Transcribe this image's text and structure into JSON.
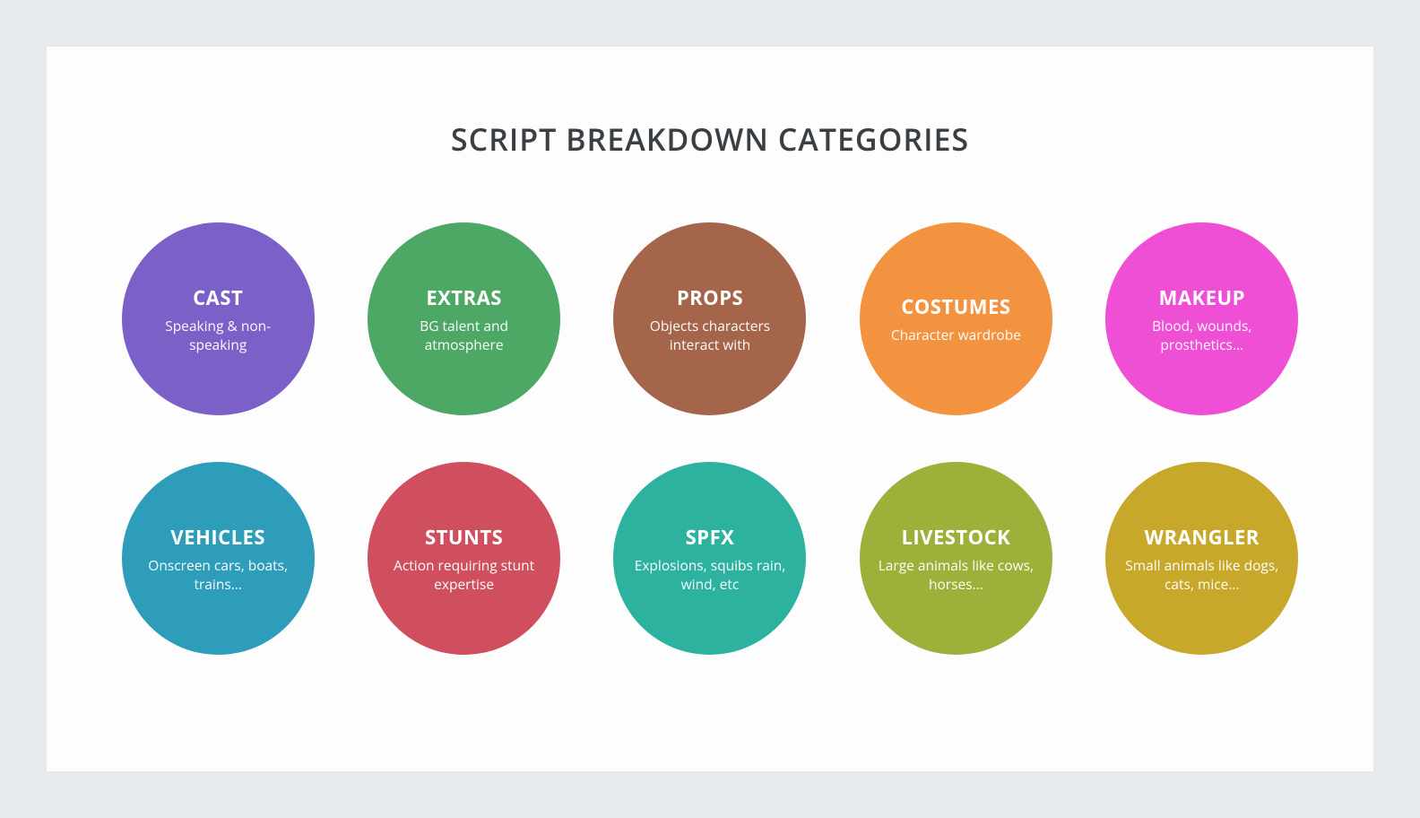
{
  "title": "SCRIPT BREAKDOWN CATEGORIES",
  "categories": [
    {
      "name": "CAST",
      "desc": "Speaking & non-speaking",
      "color": "#7a60c7"
    },
    {
      "name": "EXTRAS",
      "desc": "BG talent and atmosphere",
      "color": "#4da866"
    },
    {
      "name": "PROPS",
      "desc": "Objects characters interact with",
      "color": "#a4654b"
    },
    {
      "name": "COSTUMES",
      "desc": "Character wardrobe",
      "color": "#f3923f"
    },
    {
      "name": "MAKEUP",
      "desc": "Blood, wounds, prosthetics...",
      "color": "#ef4fd4"
    },
    {
      "name": "VEHICLES",
      "desc": "Onscreen cars, boats, trains...",
      "color": "#2d9dba"
    },
    {
      "name": "STUNTS",
      "desc": "Action requiring stunt expertise",
      "color": "#cf4f5e"
    },
    {
      "name": "SPFX",
      "desc": "Explosions, squibs rain, wind, etc",
      "color": "#2db2a0"
    },
    {
      "name": "LIVESTOCK",
      "desc": "Large animals like cows, horses...",
      "color": "#9db03a"
    },
    {
      "name": "WRANGLER",
      "desc": "Small animals like dogs, cats, mice...",
      "color": "#c7a82a"
    }
  ]
}
